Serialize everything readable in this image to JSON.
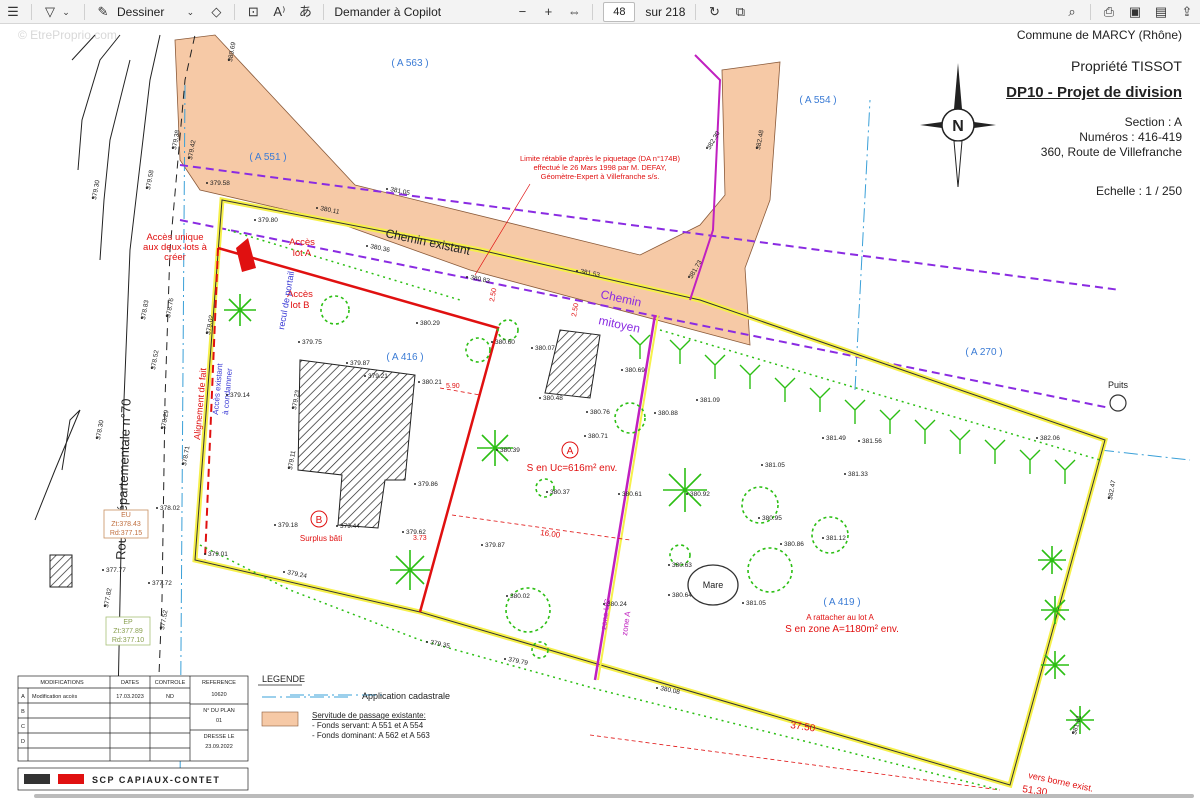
{
  "toolbar": {
    "draw_label": "Dessiner",
    "copilot_label": "Demander à Copilot",
    "page_current": "48",
    "page_total": "sur 218"
  },
  "header": {
    "commune": "Commune de MARCY (Rhône)",
    "propriete": "Propriété TISSOT",
    "title": "DP10 - Projet de division",
    "section": "Section : A",
    "numeros": "Numéros : 416-419",
    "adresse": "360, Route de Villefranche",
    "echelle": "Echelle   : 1 / 250",
    "north": "N"
  },
  "watermark": "© EtreProprio.com",
  "parcels": {
    "a563": "( A 563 )",
    "a554": "( A 554 )",
    "a551": "( A 551 )",
    "a270": "( A 270 )",
    "a416": "( A 416 )",
    "a419": "( A 419 )"
  },
  "labels": {
    "road": "Route Départementale n°70",
    "chemin_existant": "Chemin existant",
    "chemin_mitoyen_1": "Chemin",
    "chemin_mitoyen_2": "mitoyen",
    "acces_unique": [
      "Accès unique",
      "aux deux lots à",
      "créer"
    ],
    "acces_lot_a": [
      "Accès",
      "lot A"
    ],
    "acces_lot_b": [
      "Accès",
      "lot B"
    ],
    "recul": "recul de portail",
    "alignement": "Alignement de fait",
    "acces_existant": [
      "Accès existant",
      "à condamner"
    ],
    "limite_note": [
      "Limite rétablie d'après le piquetage (DA n°174B)",
      "effectué le 26 Mars 1998 par M. DEFAY,",
      "Géomètre-Expert à Villefranche s/s."
    ],
    "lot_a_circle": "A",
    "lot_a_surface": "S en Uc=616m² env.",
    "lot_b_circle": "B",
    "lot_b_text": "Surplus bâti",
    "a_rattacher": "A rattacher au lot A",
    "zone_a_surface": "S en zone A=1180m² env.",
    "mare": "Mare",
    "puits": "Puits",
    "zone_uc": "zone UC",
    "zone_a": "zone A",
    "vers_borne": "vers borne exist.",
    "dim_1600": "16.00",
    "dim_3750": "37.50",
    "dim_5130": "51.30",
    "dim_373": "3.73",
    "dim_590": "5.90",
    "dim_250a": "2.50",
    "dim_250b": "2.50",
    "eu": [
      "EU",
      "Zt:378.43",
      "Rd:377.15"
    ],
    "ep": [
      "EP",
      "Zt:377.89",
      "Rd:377.10"
    ]
  },
  "spot_heights": [
    "379.80",
    "380.11",
    "381.05",
    "380.36",
    "380.83",
    "381.53",
    "381.73",
    "382.30",
    "382.48",
    "380.69",
    "379.58",
    "379.38",
    "379.42",
    "379.30",
    "379.58",
    "379.75",
    "380.29",
    "380.60",
    "380.07",
    "380.48",
    "380.76",
    "380.69",
    "380.88",
    "381.09",
    "381.49",
    "381.56",
    "382.06",
    "382.47",
    "381.05",
    "381.33",
    "380.71",
    "380.39",
    "380.37",
    "380.61",
    "380.92",
    "380.95",
    "381.12",
    "380.86",
    "380.63",
    "380.64",
    "381.05",
    "380.24",
    "380.02",
    "379.87",
    "379.62",
    "379.44",
    "379.18",
    "379.01",
    "379.24",
    "379.35",
    "379.79",
    "380.08",
    "381.81",
    "379.86",
    "379.11",
    "379.23",
    "379.21",
    "380.21",
    "379.87",
    "379.14",
    "379.02",
    "378.83",
    "378.76",
    "378.52",
    "378.29",
    "378.71",
    "378.02",
    "377.77",
    "377.72",
    "377.82",
    "377.52",
    "378.30"
  ],
  "legend": {
    "title": "LEGENDE",
    "cadastrale": "Application cadastrale",
    "servitude_title": "Servitude de passage existante:",
    "servitude_1": "- Fonds servant: A 551 et A 554",
    "servitude_2": "- Fonds dominant: A 562 et A 563"
  },
  "cartouche": {
    "headers": [
      "MODIFICATIONS",
      "DATES",
      "CONTROLE"
    ],
    "rows": [
      {
        "letter": "A",
        "modification": "Modification accès",
        "date": "17.03.2023",
        "controle": "ND"
      },
      {
        "letter": "B",
        "modification": "",
        "date": "",
        "controle": ""
      },
      {
        "letter": "C",
        "modification": "",
        "date": "",
        "controle": ""
      },
      {
        "letter": "D",
        "modification": "",
        "date": "",
        "controle": ""
      }
    ],
    "reference_label": "REFERENCE",
    "reference_value": "10620",
    "plan_label": "N° DU PLAN",
    "plan_value": "01",
    "dresse_label": "DRESSE LE",
    "dresse_value": "23.09.2022",
    "company": "SCP  CAPIAUX-CONTET"
  },
  "colors": {
    "servitude": "#f6c9a6",
    "lot_a_boundary": "#e01010",
    "yellow_boundary": "#f6f04a",
    "magenta": "#c020c0",
    "cadastre_blue": "#3aa0d8",
    "chemin_purple": "#8a2be2",
    "vegetation": "#2cbf14"
  }
}
